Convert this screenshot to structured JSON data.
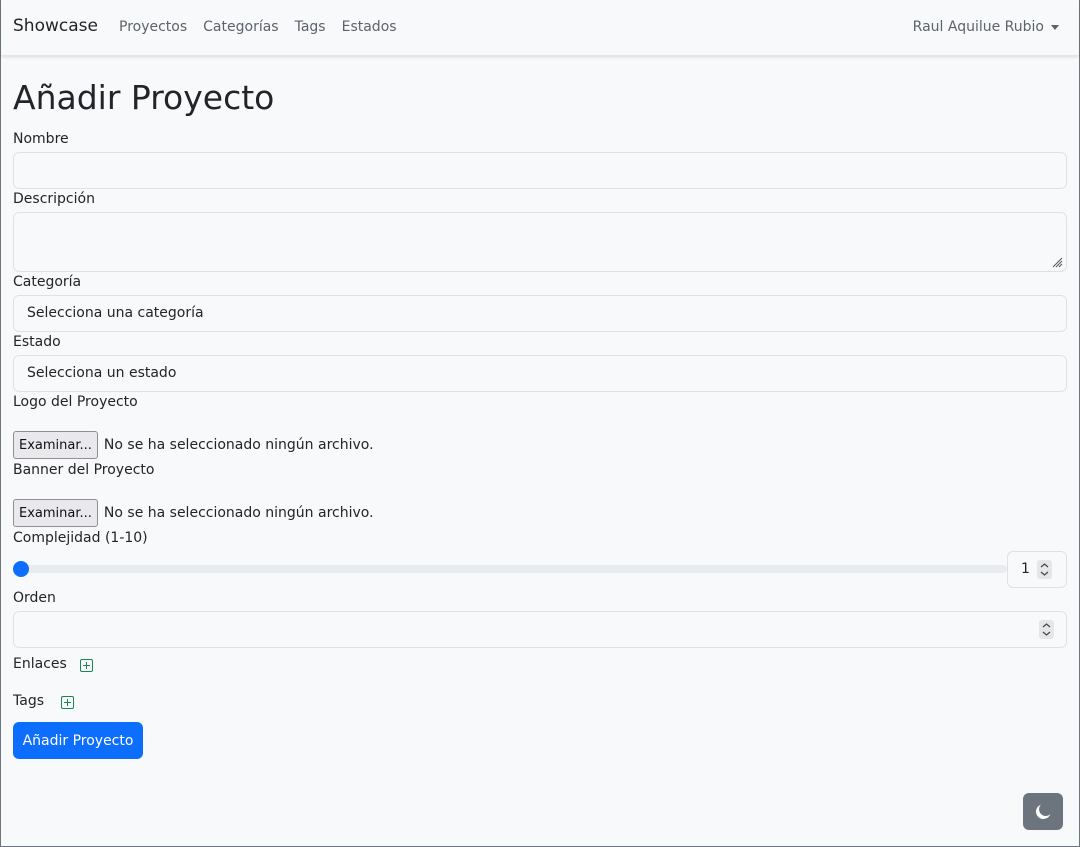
{
  "navbar": {
    "brand": "Showcase",
    "links": [
      "Proyectos",
      "Categorías",
      "Tags",
      "Estados"
    ],
    "user": "Raul Aquilue Rubio"
  },
  "page": {
    "title": "Añadir Proyecto"
  },
  "form": {
    "nombre": {
      "label": "Nombre",
      "value": ""
    },
    "descripcion": {
      "label": "Descripción",
      "value": ""
    },
    "categoria": {
      "label": "Categoría",
      "selected": "Selecciona una categoría"
    },
    "estado": {
      "label": "Estado",
      "selected": "Selecciona un estado"
    },
    "logo": {
      "label": "Logo del Proyecto",
      "button": "Examinar...",
      "status": "No se ha seleccionado ningún archivo."
    },
    "banner": {
      "label": "Banner del Proyecto",
      "button": "Examinar...",
      "status": "No se ha seleccionado ningún archivo."
    },
    "complejidad": {
      "label": "Complejidad (1-10)",
      "value": "1",
      "min": 1,
      "max": 10
    },
    "orden": {
      "label": "Orden",
      "value": ""
    },
    "enlaces": {
      "label": "Enlaces"
    },
    "tags": {
      "label": "Tags"
    },
    "submit": "Añadir Proyecto"
  },
  "colors": {
    "primary": "#0d6efd",
    "success": "#198754",
    "secondary": "#6c757d",
    "background": "#f8f9fa"
  },
  "icons": {
    "theme_toggle": "moon-icon",
    "add": "plus-square-icon"
  }
}
